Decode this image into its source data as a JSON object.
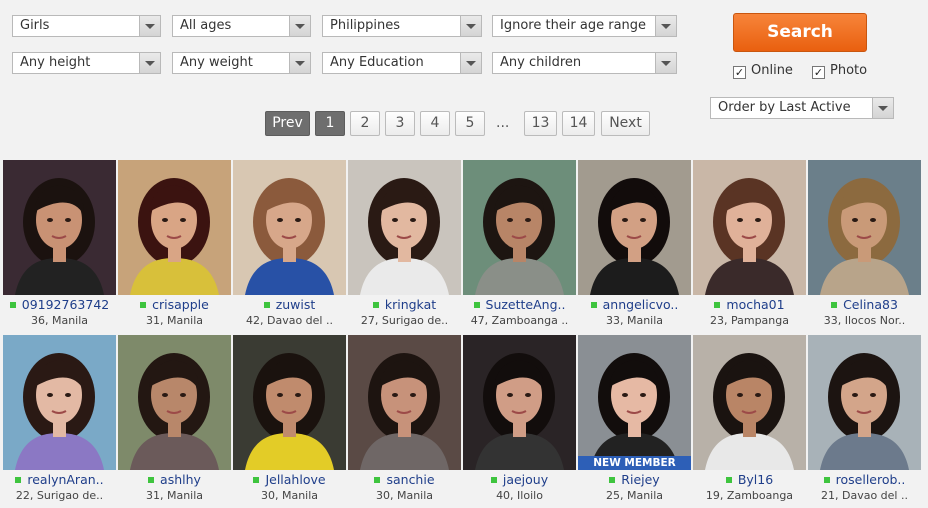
{
  "filters": {
    "row1": [
      "Girls",
      "All ages",
      "Philippines",
      "Ignore their age range"
    ],
    "row2": [
      "Any height",
      "Any weight",
      "Any Education",
      "Any children"
    ],
    "order": "Order by Last Active"
  },
  "search_label": "Search",
  "checkboxes": {
    "online": "Online",
    "photo": "Photo",
    "check_glyph": "✓"
  },
  "pagination": {
    "prev": "Prev",
    "pages": [
      "1",
      "2",
      "3",
      "4",
      "5"
    ],
    "ellipsis": "...",
    "pages_end": [
      "13",
      "14"
    ],
    "next": "Next"
  },
  "badge_new_member": "NEW MEMBER",
  "profiles": [
    {
      "name": "09192763742",
      "info": "36, Manila",
      "bg": "#3a2a33",
      "skin": "#c99274",
      "hair": "#1b120f",
      "top": "#222"
    },
    {
      "name": "crisapple",
      "info": "31, Manila",
      "bg": "#c7a37a",
      "skin": "#d9a585",
      "hair": "#3b1310",
      "top": "#d8c03a"
    },
    {
      "name": "zuwist",
      "info": "42, Davao del ..",
      "bg": "#d8c7b2",
      "skin": "#d7a78a",
      "hair": "#8b5a3c",
      "top": "#2851a6"
    },
    {
      "name": "kringkat",
      "info": "27, Surigao de..",
      "bg": "#c9c4bd",
      "skin": "#e2b8a0",
      "hair": "#2a1a14",
      "top": "#eaeaea"
    },
    {
      "name": "SuzetteAng..",
      "info": "47, Zamboanga ..",
      "bg": "#6d8e7a",
      "skin": "#b88567",
      "hair": "#1d1511",
      "top": "#8a8f88"
    },
    {
      "name": "anngelicvo..",
      "info": "33, Manila",
      "bg": "#a29b8f",
      "skin": "#d2a084",
      "hair": "#120c0b",
      "top": "#1c1c1c"
    },
    {
      "name": "mocha01",
      "info": "23, Pampanga",
      "bg": "#c9b7a7",
      "skin": "#e0b199",
      "hair": "#5a3424",
      "top": "#3a2a2a"
    },
    {
      "name": "Celina83",
      "info": "33, Ilocos Nor..",
      "bg": "#6b7f8a",
      "skin": "#c99a78",
      "hair": "#8c6a3f",
      "top": "#b8a48a"
    },
    {
      "name": "realynAran..",
      "info": "22, Surigao de..",
      "bg": "#7aa9c7",
      "skin": "#e3b9a4",
      "hair": "#2a1914",
      "top": "#8b78c4"
    },
    {
      "name": "ashlhy",
      "info": "31, Manila",
      "bg": "#7e8a6a",
      "skin": "#b8876a",
      "hair": "#231712",
      "top": "#6b5a5a"
    },
    {
      "name": "Jellahlove",
      "info": "30, Manila",
      "bg": "#3a3b33",
      "skin": "#c08b6d",
      "hair": "#1a120e",
      "top": "#e3cc27"
    },
    {
      "name": "sanchie",
      "info": "30, Manila",
      "bg": "#5a4a45",
      "skin": "#c7927a",
      "hair": "#1d1410",
      "top": "#6f6766"
    },
    {
      "name": "jaejouy",
      "info": "40, Iloilo",
      "bg": "#2a2426",
      "skin": "#d09d86",
      "hair": "#120d0c",
      "top": "#333"
    },
    {
      "name": "Riejey",
      "info": "25, Manila",
      "bg": "#8a8f94",
      "skin": "#e6b9a4",
      "hair": "#120d0c",
      "top": "#222",
      "new": true
    },
    {
      "name": "Byl16",
      "info": "19, Zamboanga",
      "bg": "#b8b1a8",
      "skin": "#b98566",
      "hair": "#1a1310",
      "top": "#e8e8e8"
    },
    {
      "name": "rosellerob..",
      "info": "21, Davao del ..",
      "bg": "#a8b2b8",
      "skin": "#d3a58a",
      "hair": "#1c1411",
      "top": "#6c7a8c"
    }
  ]
}
